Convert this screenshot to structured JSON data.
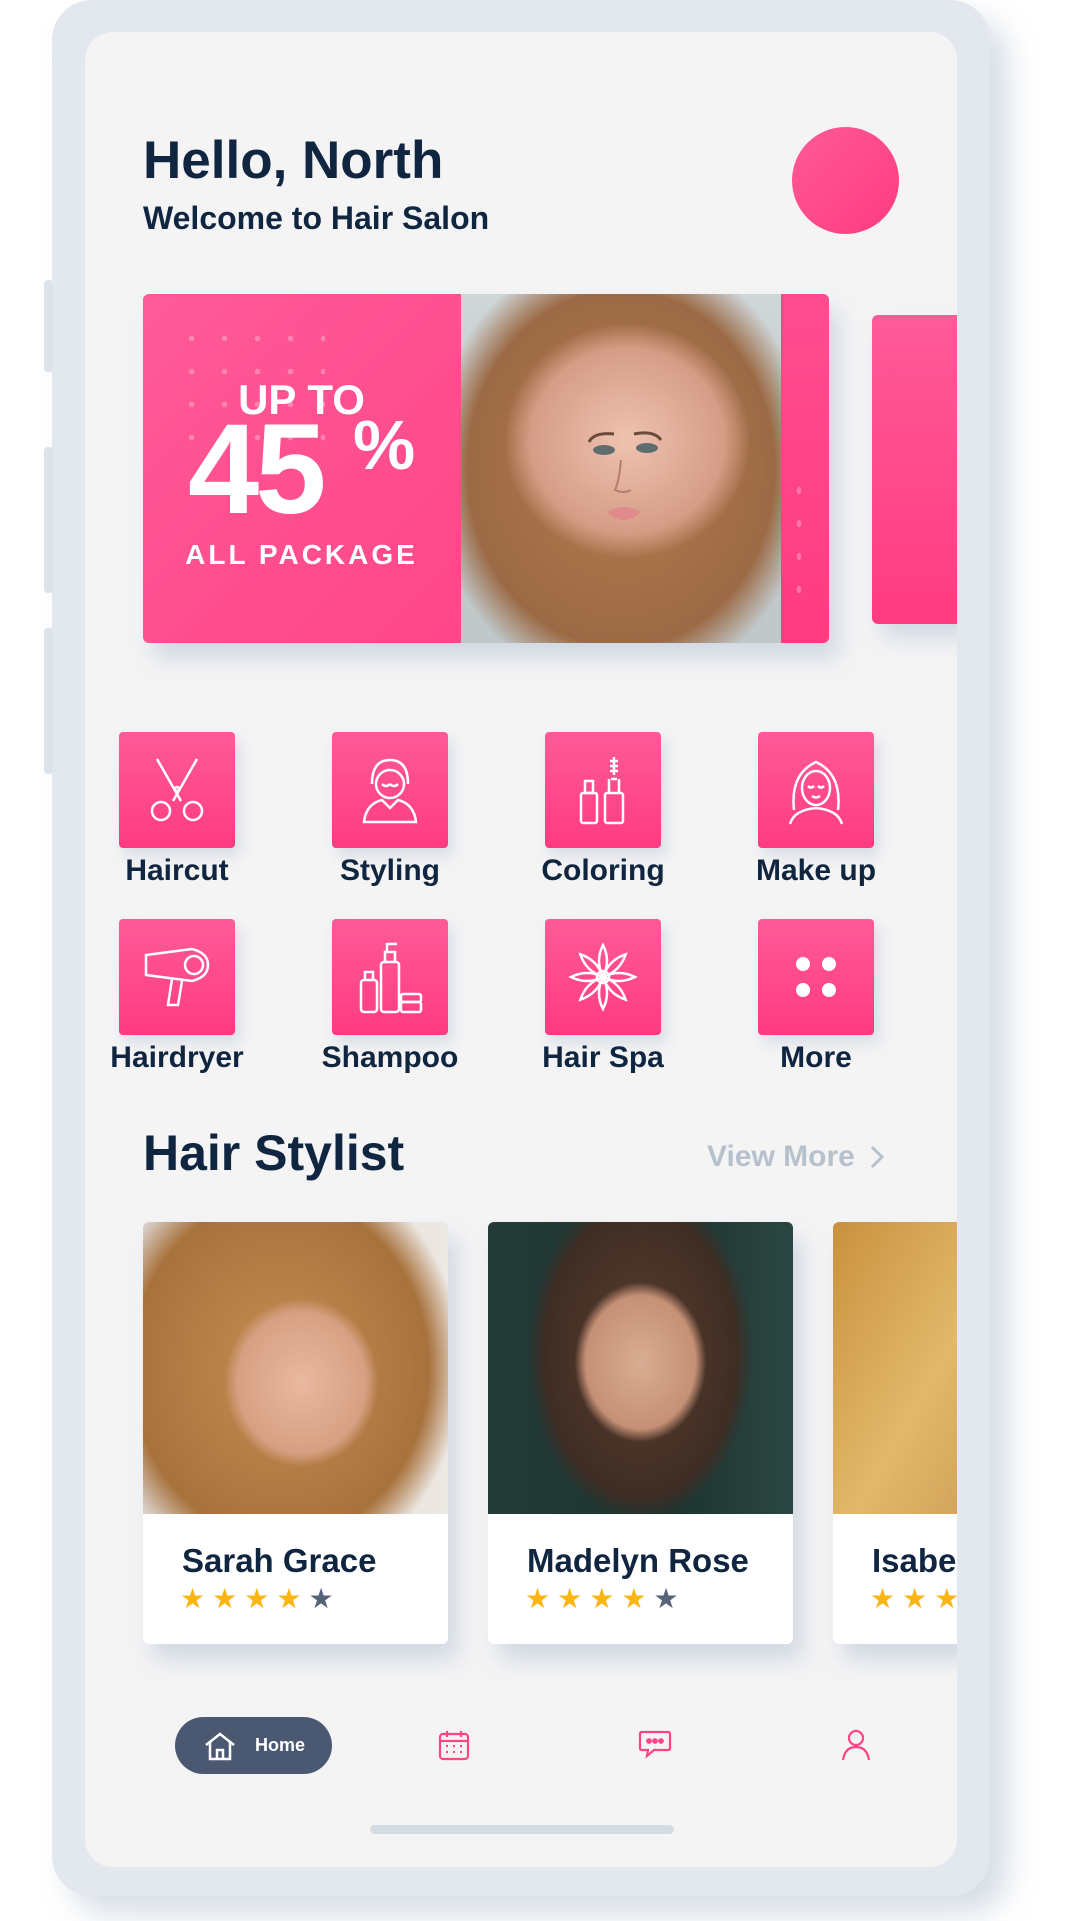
{
  "header": {
    "greeting": "Hello, North",
    "subtitle": "Welcome to Hair Salon"
  },
  "promo": {
    "up_to": "UP TO",
    "percent": "45",
    "percent_sign": "%",
    "package": "ALL PACKAGE"
  },
  "categories": [
    {
      "label": "Haircut",
      "icon": "scissors-icon"
    },
    {
      "label": "Styling",
      "icon": "stylist-icon"
    },
    {
      "label": "Coloring",
      "icon": "cosmetics-icon"
    },
    {
      "label": "Make up",
      "icon": "woman-face-icon"
    },
    {
      "label": "Hairdryer",
      "icon": "hairdryer-icon"
    },
    {
      "label": "Shampoo",
      "icon": "bottles-icon"
    },
    {
      "label": "Hair Spa",
      "icon": "lotus-icon"
    },
    {
      "label": "More",
      "icon": "grid-dots-icon"
    }
  ],
  "stylists": {
    "title": "Hair Stylist",
    "view_more": "View More",
    "items": [
      {
        "name": "Sarah Grace",
        "rating": 4,
        "max_rating": 5
      },
      {
        "name": "Madelyn Rose",
        "rating": 4,
        "max_rating": 5
      },
      {
        "name": "Isabe",
        "rating": 3,
        "max_rating": 5
      }
    ]
  },
  "nav": {
    "home_label": "Home",
    "items": [
      "home-icon",
      "calendar-icon",
      "chat-icon",
      "profile-icon"
    ]
  },
  "colors": {
    "accent": "#ff4488",
    "text_dark": "#102540",
    "nav_active": "#4a5872",
    "star": "#fbb614"
  }
}
